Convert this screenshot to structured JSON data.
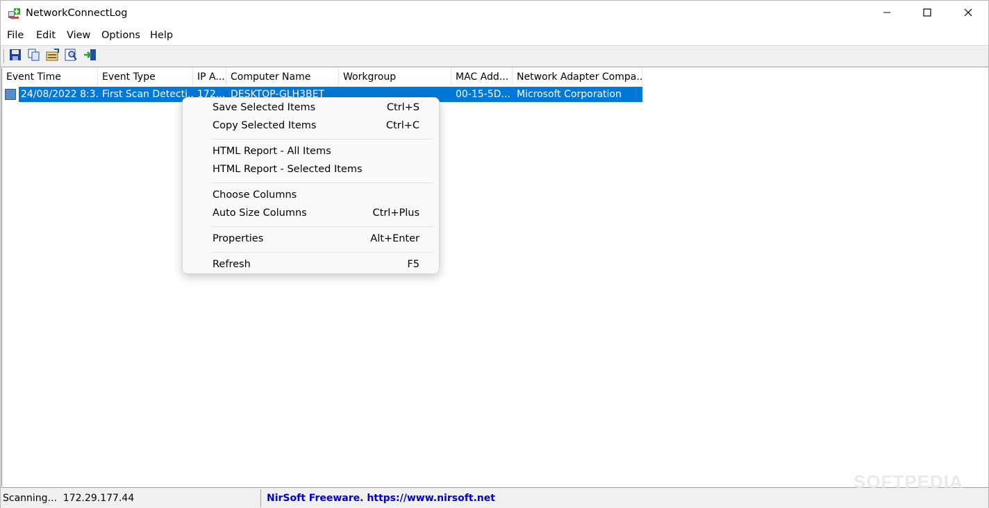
{
  "window": {
    "title": "NetworkConnectLog"
  },
  "menubar": {
    "items": [
      "File",
      "Edit",
      "View",
      "Options",
      "Help"
    ]
  },
  "toolbar": {
    "buttons": [
      "save-icon",
      "copy-icon",
      "properties-icon",
      "find-icon",
      "exit-icon"
    ]
  },
  "table": {
    "columns": [
      "Event Time",
      "Event Type",
      "IP A...",
      "Computer Name",
      "Workgroup",
      "MAC Add...",
      "Network Adapter Compa..."
    ],
    "rows": [
      [
        "24/08/2022 8:3...",
        "First Scan Detecti...",
        "172...",
        "DESKTOP-GLH3BET",
        "",
        "00-15-5D...",
        "Microsoft Corporation"
      ]
    ]
  },
  "context_menu": {
    "items": [
      {
        "label": "Save Selected Items",
        "shortcut": "Ctrl+S"
      },
      {
        "label": "Copy Selected Items",
        "shortcut": "Ctrl+C"
      },
      {
        "label": "HTML Report - All Items",
        "shortcut": ""
      },
      {
        "label": "HTML Report - Selected Items",
        "shortcut": ""
      },
      {
        "label": "Choose Columns",
        "shortcut": ""
      },
      {
        "label": "Auto Size Columns",
        "shortcut": "Ctrl+Plus"
      },
      {
        "label": "Properties",
        "shortcut": "Alt+Enter"
      },
      {
        "label": "Refresh",
        "shortcut": "F5"
      }
    ]
  },
  "statusbar": {
    "left": "Scanning...  172.29.177.44",
    "right": "NirSoft Freeware. https://www.nirsoft.net"
  },
  "watermark": "SOFTPEDIA",
  "colors": {
    "selection": "#0078d7",
    "link": "#0000cc"
  }
}
